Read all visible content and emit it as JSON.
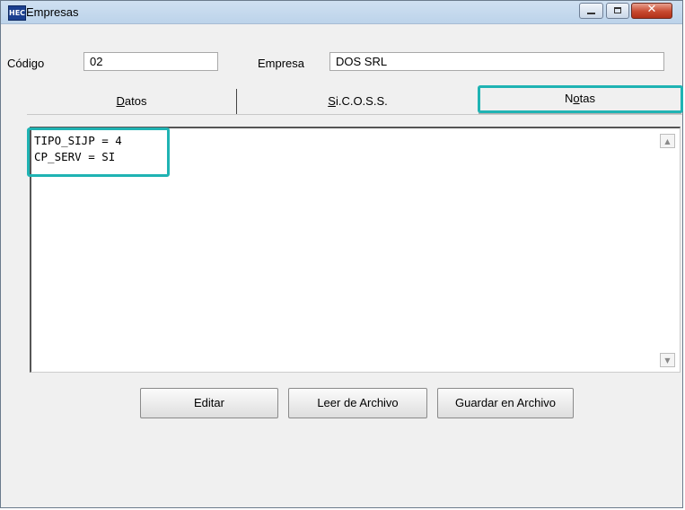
{
  "window": {
    "title": "Empresas",
    "app_icon": "HEC",
    "controls": {
      "minimize": "minimize-icon",
      "maximize": "maximize-icon",
      "close": "close-icon"
    }
  },
  "form": {
    "codigo_label": "Código",
    "codigo_value": "02",
    "empresa_label": "Empresa",
    "empresa_value": "DOS SRL"
  },
  "tabs": [
    {
      "label_pre": "",
      "label_u": "D",
      "label_post": "atos",
      "selected": false
    },
    {
      "label_pre": "",
      "label_u": "S",
      "label_post": "i.C.O.S.S.",
      "selected": false
    },
    {
      "label_pre": "N",
      "label_u": "o",
      "label_post": "tas",
      "selected": true
    }
  ],
  "notes": {
    "lines": [
      "TIPO_SIJP = 4",
      "CP_SERV = SI"
    ],
    "scroll_up_icon": "scroll-up-arrow-icon",
    "scroll_down_icon": "scroll-down-arrow-icon"
  },
  "buttons": {
    "editar": "Editar",
    "leer": "Leer de Archivo",
    "guardar": "Guardar en Archivo"
  },
  "colors": {
    "highlight": "#1fb3b3",
    "titlebar": "#c4d8ee",
    "close_button": "#c84a30"
  }
}
